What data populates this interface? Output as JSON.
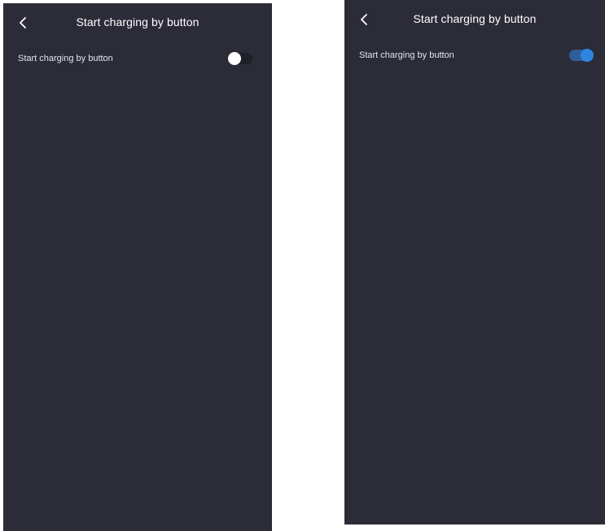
{
  "screens": [
    {
      "header": {
        "title": "Start charging by button",
        "back_icon": "chevron-left-icon"
      },
      "setting": {
        "label": "Start charging by button",
        "enabled": false
      }
    },
    {
      "header": {
        "title": "Start charging by button",
        "back_icon": "chevron-left-icon"
      },
      "setting": {
        "label": "Start charging by button",
        "enabled": true
      }
    }
  ],
  "colors": {
    "screen_background": "#2c2c39",
    "toggle_off_track": "#1f1f28",
    "toggle_off_knob": "#ffffff",
    "toggle_on_track": "#2f5f9a",
    "toggle_on_knob": "#2f86e0",
    "text_primary": "#ffffff"
  }
}
